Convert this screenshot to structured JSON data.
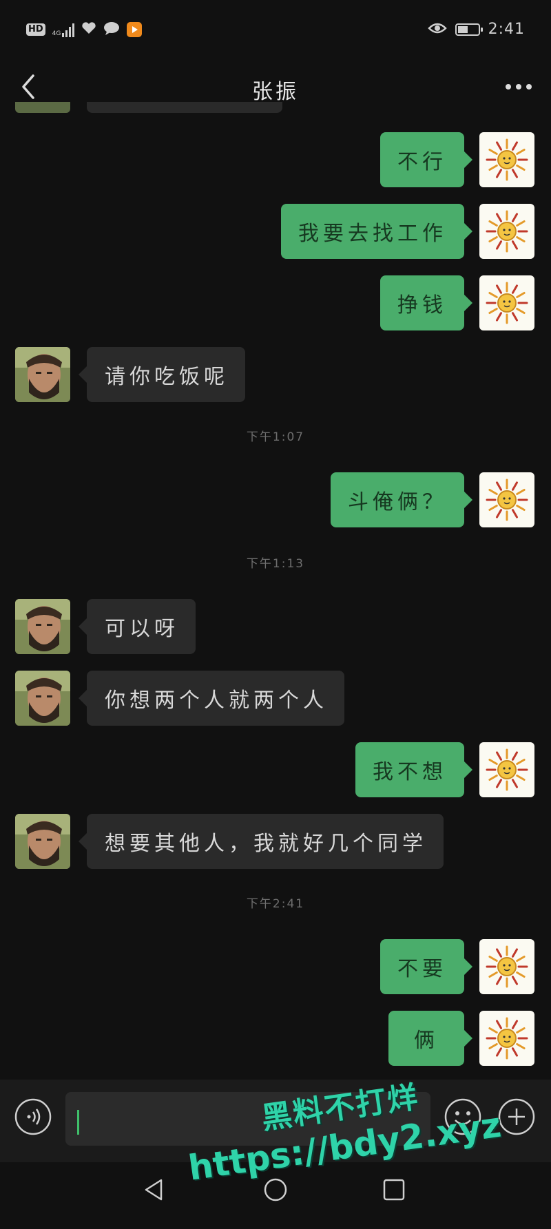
{
  "status_bar": {
    "hd_label": "HD",
    "network_label": "4G",
    "time": "2:41",
    "icons": [
      "hd-icon",
      "signal-icon",
      "health-icon",
      "chat-icon",
      "video-app-icon",
      "eye-icon",
      "battery-icon"
    ]
  },
  "header": {
    "title": "张振",
    "back_icon": "chevron-left-icon",
    "more_icon": "more-icon"
  },
  "messages": [
    {
      "side": "out",
      "text": "不行"
    },
    {
      "side": "out",
      "text": "我要去找工作"
    },
    {
      "side": "out",
      "text": "挣钱"
    },
    {
      "side": "in",
      "text": "请你吃饭呢"
    },
    {
      "type": "time",
      "text": "下午1:07"
    },
    {
      "side": "out",
      "text": "斗俺俩？"
    },
    {
      "type": "time",
      "text": "下午1:13"
    },
    {
      "side": "in",
      "text": "可以呀"
    },
    {
      "side": "in",
      "text": "你想两个人就两个人"
    },
    {
      "side": "out",
      "text": "我不想"
    },
    {
      "side": "in",
      "text": "想要其他人，我就好几个同学"
    },
    {
      "type": "time",
      "text": "下午2:41"
    },
    {
      "side": "out",
      "text": "不要"
    },
    {
      "side": "out",
      "text": "俩"
    }
  ],
  "input_bar": {
    "voice_icon": "voice-icon",
    "input_value": "",
    "emoji_icon": "emoji-icon",
    "plus_icon": "plus-icon"
  },
  "nav_bar": {
    "icons": [
      "nav-back-icon",
      "nav-home-icon",
      "nav-recent-icon"
    ]
  },
  "watermark": {
    "line1": "黑料不打烊",
    "line2": "https://bdy2.xyz"
  },
  "colors": {
    "background": "#111111",
    "bubble_out": "#4aad6b",
    "bubble_in": "#2a2a2a",
    "watermark": "#2fd3a9"
  }
}
